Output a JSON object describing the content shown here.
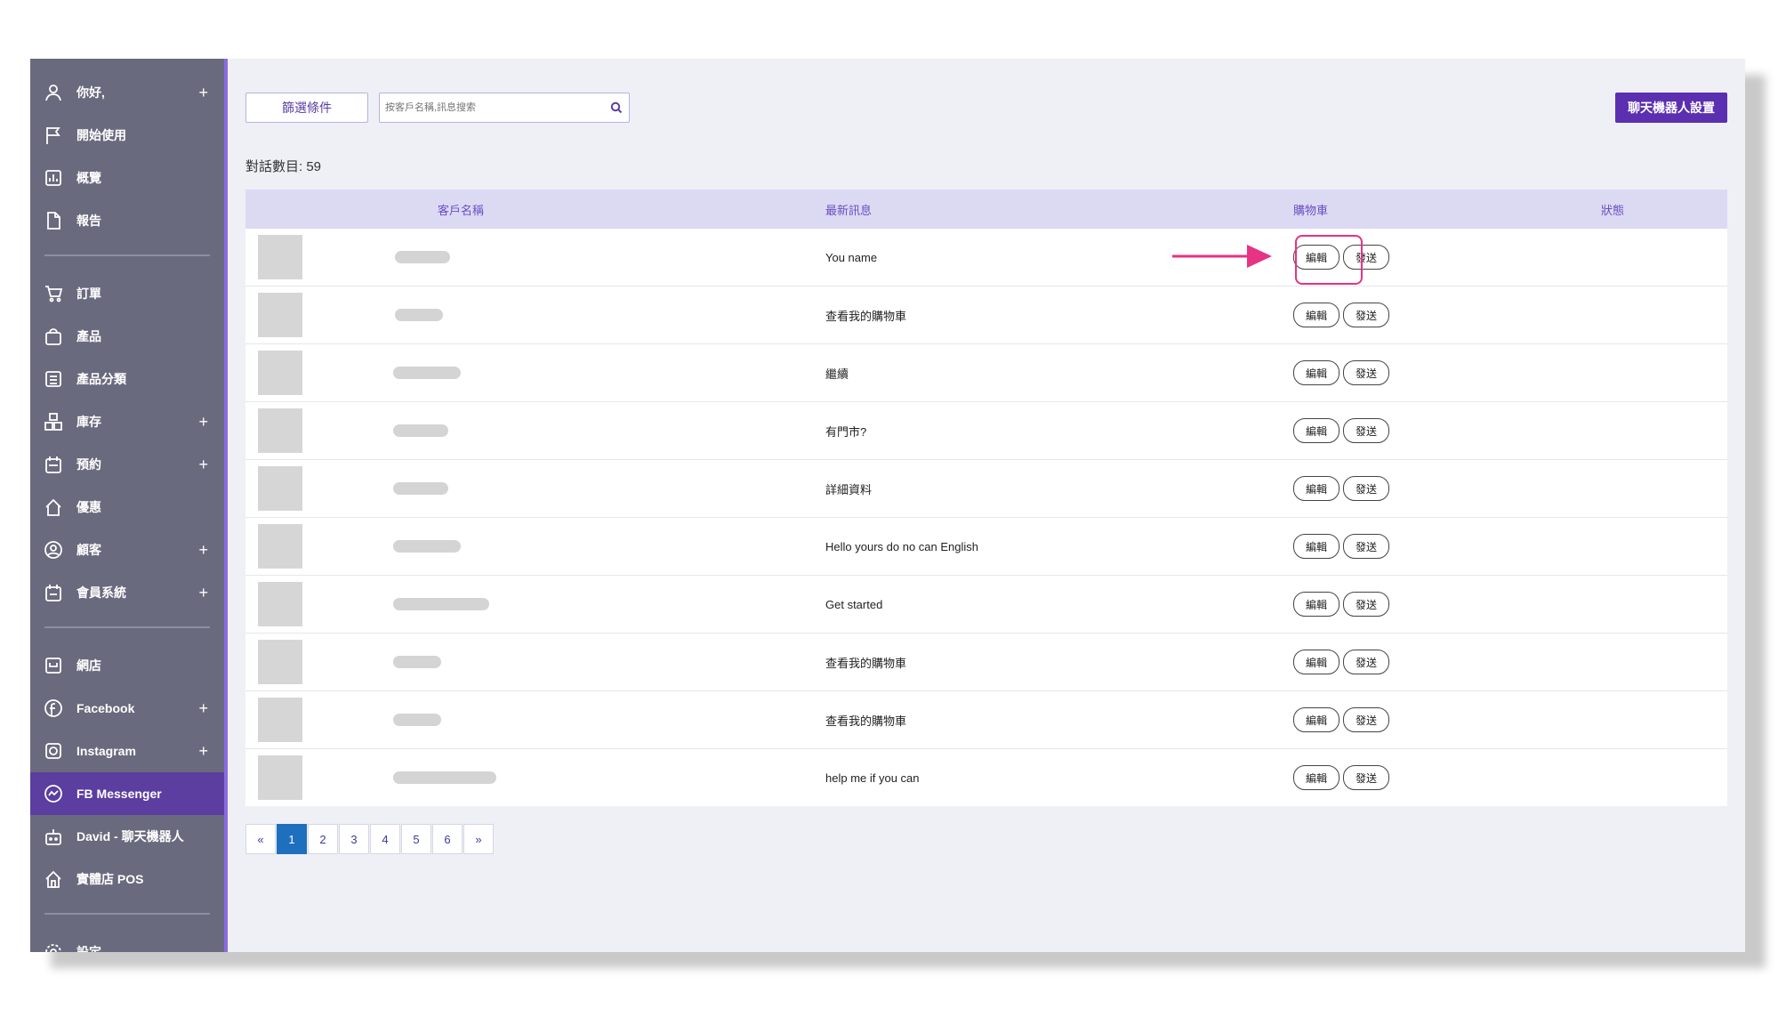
{
  "sidebar": {
    "items": [
      {
        "label": "你好,",
        "icon": "user-icon",
        "plus": "+"
      },
      {
        "label": "開始使用",
        "icon": "flag-icon"
      },
      {
        "label": "概覽",
        "icon": "chart-icon"
      },
      {
        "label": "報告",
        "icon": "document-icon"
      },
      {
        "label": "訂單",
        "icon": "cart-icon"
      },
      {
        "label": "產品",
        "icon": "bag-icon"
      },
      {
        "label": "產品分類",
        "icon": "list-icon"
      },
      {
        "label": "庫存",
        "icon": "inventory-icon",
        "plus": "+"
      },
      {
        "label": "預約",
        "icon": "calendar-icon",
        "plus": "+"
      },
      {
        "label": "優惠",
        "icon": "home-icon"
      },
      {
        "label": "顧客",
        "icon": "customer-icon",
        "plus": "+"
      },
      {
        "label": "會員系統",
        "icon": "member-icon",
        "plus": "+"
      },
      {
        "label": "網店",
        "icon": "shop-icon"
      },
      {
        "label": "Facebook",
        "icon": "facebook-icon",
        "plus": "+"
      },
      {
        "label": "Instagram",
        "icon": "instagram-icon",
        "plus": "+"
      },
      {
        "label": "FB Messenger",
        "icon": "messenger-icon",
        "active": true
      },
      {
        "label": "David - 聊天機器人",
        "icon": "bot-icon"
      },
      {
        "label": "實體店 POS",
        "icon": "pos-icon"
      },
      {
        "label": "設定",
        "icon": "gear-icon"
      }
    ]
  },
  "toolbar": {
    "filter_label": "篩選條件",
    "search_placeholder": "按客戶名稱,訊息搜索",
    "bot_settings_label": "聊天機器人設置"
  },
  "count_label": "對話數目: 59",
  "table": {
    "headers": {
      "name": "客戶名稱",
      "message": "最新訊息",
      "cart": "購物車",
      "status": "狀態"
    },
    "edit_label": "編輯",
    "send_label": "發送",
    "rows": [
      {
        "message": "You name"
      },
      {
        "message": "查看我的購物車"
      },
      {
        "message": "繼續"
      },
      {
        "message": "有門市?"
      },
      {
        "message": "詳細資料"
      },
      {
        "message": "Hello yours do no can English"
      },
      {
        "message": "Get started"
      },
      {
        "message": "查看我的購物車"
      },
      {
        "message": "查看我的購物車"
      },
      {
        "message": "help me if you can"
      }
    ]
  },
  "pagination": {
    "prev": "«",
    "pages": [
      "1",
      "2",
      "3",
      "4",
      "5",
      "6"
    ],
    "current": "1",
    "next": "»"
  },
  "colors": {
    "accent": "#5b2fb0",
    "highlight": "#e63383",
    "sidebar": "#6a6a7e"
  }
}
